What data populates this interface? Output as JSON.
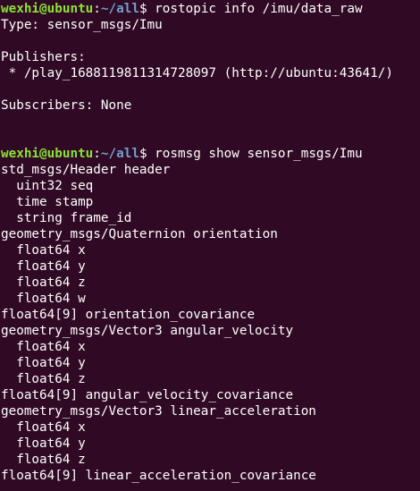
{
  "prompt": {
    "user_host": "wexhi@ubuntu",
    "separator": ":",
    "cwd": "~/all",
    "symbol": "$"
  },
  "commands": [
    "rostopic info /imu/data_raw",
    "rosmsg show sensor_msgs/Imu"
  ],
  "output_info": [
    "Type: sensor_msgs/Imu",
    "",
    "Publishers:",
    " * /play_1688119811314728097 (http://ubuntu:43641/)",
    "",
    "Subscribers: None",
    "",
    ""
  ],
  "output_msg": [
    "std_msgs/Header header",
    "  uint32 seq",
    "  time stamp",
    "  string frame_id",
    "geometry_msgs/Quaternion orientation",
    "  float64 x",
    "  float64 y",
    "  float64 z",
    "  float64 w",
    "float64[9] orientation_covariance",
    "geometry_msgs/Vector3 angular_velocity",
    "  float64 x",
    "  float64 y",
    "  float64 z",
    "float64[9] angular_velocity_covariance",
    "geometry_msgs/Vector3 linear_acceleration",
    "  float64 x",
    "  float64 y",
    "  float64 z",
    "float64[9] linear_acceleration_covariance"
  ]
}
